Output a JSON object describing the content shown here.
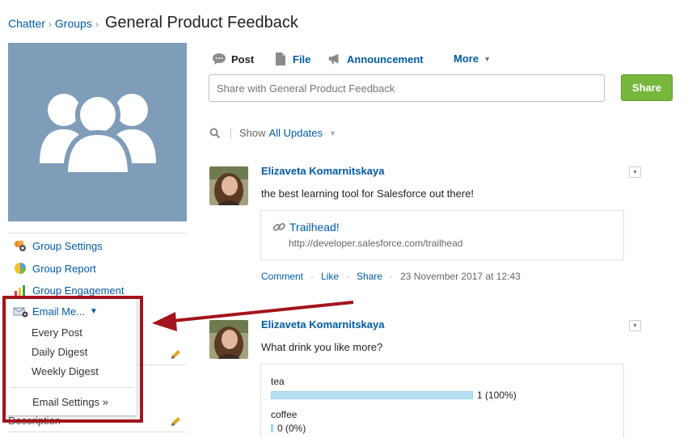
{
  "breadcrumb": {
    "items": [
      "Chatter",
      "Groups"
    ],
    "separator": "›",
    "title": "General Product Feedback"
  },
  "sidebar": {
    "links": [
      {
        "label": "Group Settings",
        "icon": "group-settings-icon"
      },
      {
        "label": "Group Report",
        "icon": "report-icon"
      },
      {
        "label": "Group Engagement",
        "icon": "engagement-icon"
      }
    ],
    "description_label": "Description"
  },
  "email_menu": {
    "label": "Email Me...",
    "options": [
      "Every Post",
      "Daily Digest",
      "Weekly Digest"
    ],
    "settings_label": "Email Settings »"
  },
  "publisher": {
    "tabs": [
      {
        "label": "Post",
        "icon": "speech-bubble-icon"
      },
      {
        "label": "File",
        "icon": "file-icon"
      },
      {
        "label": "Announcement",
        "icon": "megaphone-icon"
      },
      {
        "label": "More"
      }
    ],
    "placeholder": "Share with General Product Feedback",
    "share_label": "Share"
  },
  "filter": {
    "show_label": "Show",
    "value": "All Updates"
  },
  "feed": [
    {
      "author": "Elizaveta Komarnitskaya",
      "text": "the best learning tool for Salesforce out there!",
      "link": {
        "title": "Trailhead!",
        "url": "http://developer.salesforce.com/trailhead"
      },
      "actions": [
        "Comment",
        "Like",
        "Share"
      ],
      "timestamp": "23 November 2017 at 12:43"
    },
    {
      "author": "Elizaveta Komarnitskaya",
      "text": "What drink you like more?",
      "poll": [
        {
          "label": "tea",
          "result": "1 (100%)",
          "fraction": 1.0
        },
        {
          "label": "coffee",
          "result": "0 (0%)",
          "fraction": 0.0
        }
      ]
    }
  ],
  "colors": {
    "link": "#015ba7",
    "share_button": "#76b73c",
    "highlight": "#a3141e",
    "group_photo": "#7f9db9"
  }
}
